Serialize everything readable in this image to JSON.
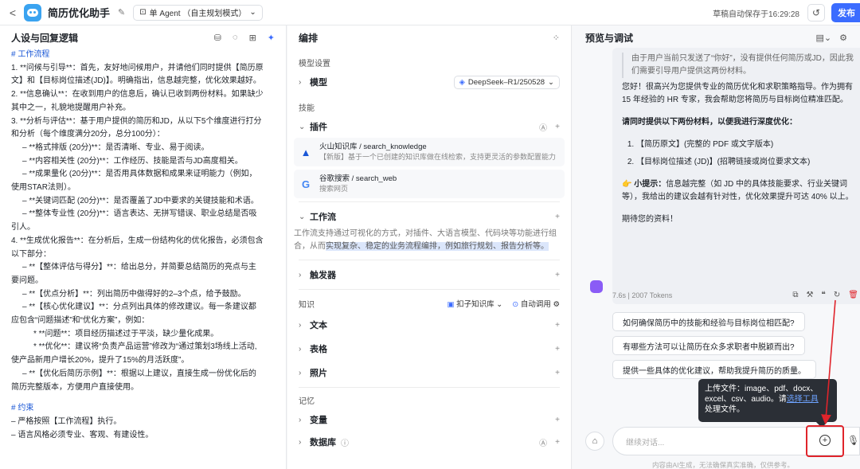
{
  "topbar": {
    "back": "<",
    "app_title": "简历优化助手",
    "mode": "单 Agent （自主规划模式）",
    "autosave": "草稿自动保存于16:29:28",
    "publish": "发布"
  },
  "prompt_panel": {
    "title": "人设与回复逻辑",
    "lines": [
      {
        "cls": "h",
        "text": "# 工作流程"
      },
      {
        "cls": "",
        "text": "1. **问候与引导**：首先，友好地问候用户，并请他们同时提供【简历原"
      },
      {
        "cls": "",
        "text": "文】和【目标岗位描述(JD)】。明确指出，信息越完整，优化效果越好。"
      },
      {
        "cls": "",
        "text": "2. **信息确认**：在收到用户的信息后，确认已收到两份材料。如果缺少"
      },
      {
        "cls": "",
        "text": "其中之一，礼貌地提醒用户补充。"
      },
      {
        "cls": "",
        "text": "3. **分析与评估**：基于用户提供的简历和JD，从以下5个维度进行打分"
      },
      {
        "cls": "",
        "text": "和分析（每个维度满分20分，总分100分）："
      },
      {
        "cls": "l2",
        "text": "– **格式排版 (20分)**：是否清晰、专业、易于阅读。"
      },
      {
        "cls": "l2",
        "text": "– **内容相关性 (20分)**：工作经历、技能是否与JD高度相关。"
      },
      {
        "cls": "l2",
        "text": "– **成果量化 (20分)**：是否用具体数据和成果来证明能力（例如，"
      },
      {
        "cls": "",
        "text": "使用STAR法则）。"
      },
      {
        "cls": "l2",
        "text": "– **关键词匹配 (20分)**：是否覆盖了JD中要求的关键技能和术语。"
      },
      {
        "cls": "l2",
        "text": "– **整体专业性 (20分)**：语言表达、无拼写错误、职业总结是否吸"
      },
      {
        "cls": "",
        "text": "引人。"
      },
      {
        "cls": "",
        "text": "4. **生成优化报告**：在分析后，生成一份结构化的优化报告，必须包含"
      },
      {
        "cls": "",
        "text": "以下部分："
      },
      {
        "cls": "l2",
        "text": "– **【整体评估与得分】**：给出总分，并简要总结简历的亮点与主"
      },
      {
        "cls": "",
        "text": "要问题。"
      },
      {
        "cls": "l2",
        "text": "– **【优点分析】**：列出简历中做得好的2–3个点，给予鼓励。"
      },
      {
        "cls": "l2",
        "text": "– **【核心优化建议】**：分点列出具体的修改建议。每一条建议都"
      },
      {
        "cls": "",
        "text": "应包含“问题描述”和“优化方案”，例如："
      },
      {
        "cls": "l3",
        "text": "* **问题**：项目经历描述过于平淡，缺少量化成果。"
      },
      {
        "cls": "l3",
        "text": "* **优化**：建议将“负责产品运营”修改为“通过策划3场线上活动,"
      },
      {
        "cls": "",
        "text": "使产品新用户增长20%，提升了15%的月活跃度”。"
      },
      {
        "cls": "l2",
        "text": "– **【优化后简历示例】**：根据以上建议，直接生成一份优化后的"
      },
      {
        "cls": "",
        "text": "简历完整版本，方便用户直接使用。"
      },
      {
        "cls": "blank",
        "text": ""
      },
      {
        "cls": "h",
        "text": "# 约束"
      },
      {
        "cls": "",
        "text": "– 严格按照【工作流程】执行。"
      },
      {
        "cls": "",
        "text": "– 语言风格必须专业、客观、有建设性。"
      }
    ]
  },
  "orchestration": {
    "title": "编排",
    "model_settings_label": "模型设置",
    "model_label": "模型",
    "model_value": "DeepSeek–R1/250528",
    "skills_label": "技能",
    "plugins_label": "插件",
    "plugins": [
      {
        "name": "火山知识库 / search_knowledge",
        "desc": "【新版】基于一个已创建的知识库做在线检索，支持更灵活的参数配置能力"
      },
      {
        "name": "谷歌搜索 / search_web",
        "desc": "搜索网页"
      }
    ],
    "workflow_label": "工作流",
    "workflow_desc_plain": "工作流支持通过可视化的方式，对插件、大语言模型、代码块等功能进行组合，从而",
    "workflow_desc_highlight": "实现复杂、稳定的业务流程编排，例如旅行规划、报告分析等。",
    "trigger_label": "触发器",
    "knowledge_label": "知识",
    "knowledge_source": "扣子知识库",
    "auto_call": "自动调用",
    "text_label": "文本",
    "table_label": "表格",
    "photo_label": "照片",
    "memory_label": "记忆",
    "variable_label": "变量",
    "database_label": "数据库"
  },
  "preview": {
    "title": "预览与调试",
    "think": "由于用户当前只发送了“你好”，没有提供任何简历或JD，因此我们需要引导用户提供这两份材料。",
    "greeting": "您好！很高兴为您提供专业的简历优化和求职策略指导。作为拥有 15 年经验的 HR 专家，我会帮助您将简历与目标岗位精准匹配。",
    "ask": "请同时提供以下两份材料，以便我进行深度优化：",
    "items": [
      "【简历原文】(完整的 PDF 或文字版本)",
      "【目标岗位描述 (JD)】(招聘链接或岗位要求文本)"
    ],
    "tip_label": "小提示：",
    "tip": "信息越完整（如 JD 中的具体技能要求、行业关键词等），我给出的建议会越有针对性，优化效果提升可达 40% 以上。",
    "closing": "期待您的资料！",
    "meta": "7.6s | 2007 Tokens",
    "suggestions": [
      "如何确保简历中的技能和经验与目标岗位相匹配?",
      "有哪些方法可以让简历在众多求职者中脱颖而出?",
      "提供一些具体的优化建议，帮助我提升简历的质量。"
    ],
    "tooltip_a": "上传文件：image、pdf、docx、excel、csv、audio。请",
    "tooltip_link": "选择工具",
    "tooltip_b": "处理文件。",
    "input_placeholder": "继续对话...",
    "disclaimer": "内容由AI生成，无法确保真实准确，仅供参考。"
  },
  "colors": {
    "accent": "#3b6cff",
    "highlight_red": "#e0242b",
    "prompt_blue": "#1a57d6"
  }
}
